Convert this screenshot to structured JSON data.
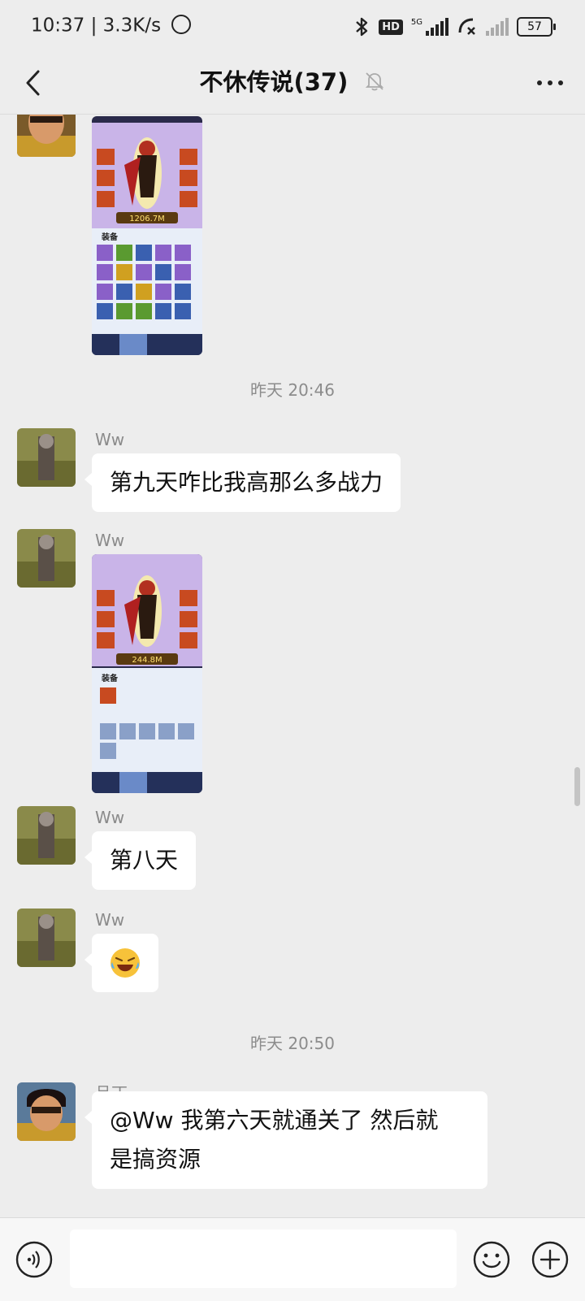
{
  "status_bar": {
    "time": "10:37",
    "speed": "3.3K/s",
    "network_label": "5G",
    "hd_label": "HD",
    "battery": "57"
  },
  "header": {
    "title": "不休传说(37)"
  },
  "messages": [
    {
      "type": "timestamp",
      "text": "昨天 20:46"
    },
    {
      "sender": "Ww",
      "text": "第九天咋比我高那么多战力"
    },
    {
      "sender": "Ww",
      "image": "game-screenshot"
    },
    {
      "sender": "Ww",
      "text": "第八天"
    },
    {
      "sender": "Ww",
      "emoji": "😂"
    },
    {
      "type": "timestamp",
      "text": "昨天 20:50"
    },
    {
      "sender": "旦丁",
      "text_line1": "@Ww  我第六天就通关了  然后就",
      "text_line2": "是搞资源"
    }
  ],
  "game_screenshot": {
    "equip_label": "装备",
    "power_1": "1206.7M",
    "power_2": "244.8M"
  },
  "input": {
    "value": "",
    "placeholder": ""
  },
  "colors": {
    "background": "#ededed",
    "bubble": "#ffffff",
    "meta_text": "#8c8c8c"
  }
}
